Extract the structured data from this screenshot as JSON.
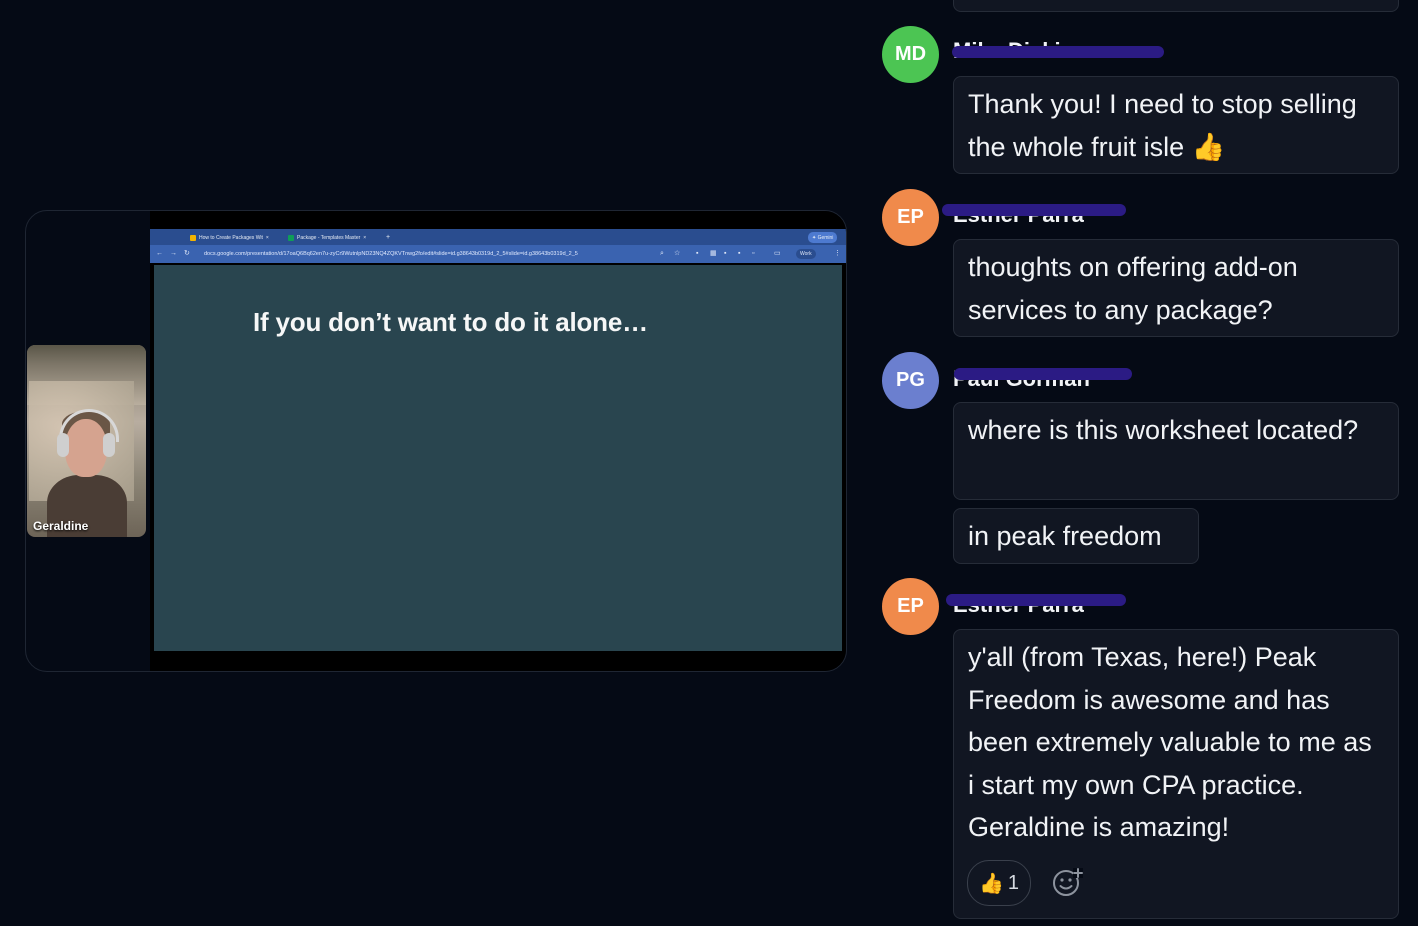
{
  "stage": {
    "participant_name": "Geraldine",
    "browser": {
      "tabs": [
        {
          "label": "How to Create Packages Wit"
        },
        {
          "label": "Package - Templates Master"
        }
      ],
      "new_tab": "+",
      "gemini_label": "✦ Gemini",
      "url": "docs.google.com/presentation/d/17oaQ6Bq62en7u-zyCr9WutnlpND23NQ4ZQKVTnwg2fo/edit#slide=id.g38643b0319d_2_5#slide=id.g38643b0319d_2_5",
      "profile_label": "Work"
    },
    "slide_title": "If you don’t want to do it alone…"
  },
  "chat": {
    "messages": [
      {
        "initials": "MD",
        "color": "#4cc553",
        "name": "Mike Dickinson",
        "text": "Thank you! I need to stop selling the whole fruit isle 👍"
      },
      {
        "initials": "EP",
        "color": "#f08a4b",
        "name": "Esther Parra",
        "text": "thoughts on offering add-on services to any package?"
      },
      {
        "initials": "PG",
        "color": "#6b7fcf",
        "name": "Paul Gorman",
        "text": "where is this worksheet located?",
        "followup": "in peak freedom"
      },
      {
        "initials": "EP",
        "color": "#f08a4b",
        "name": "Esther Parra",
        "text": "y'all (from Texas, here!) Peak Freedom is awesome and has been extremely valuable to me as i start my own CPA practice. Geraldine is amazing!"
      }
    ],
    "reaction": {
      "emoji": "👍",
      "count": "1"
    }
  }
}
